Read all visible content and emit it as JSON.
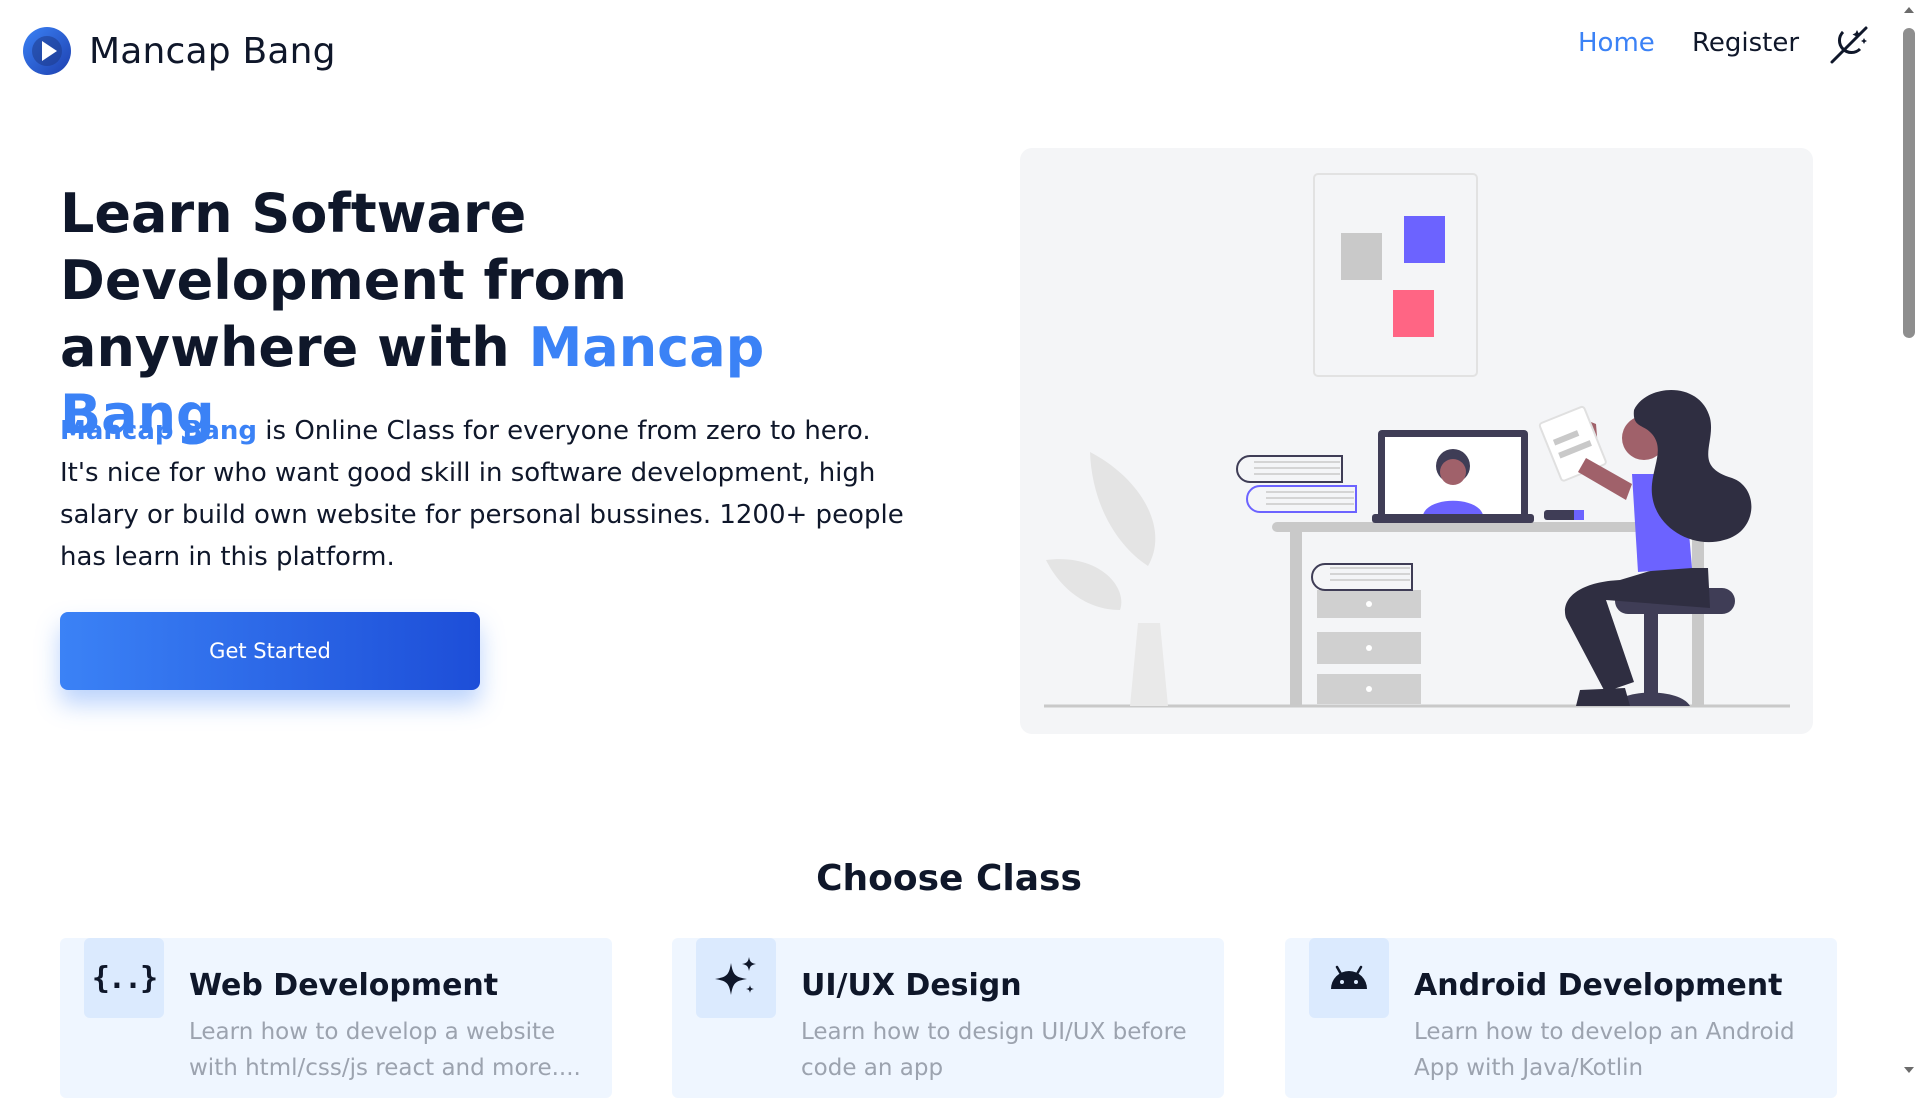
{
  "brand": {
    "name": "Mancap Bang",
    "logo_icon": "play-circle-icon"
  },
  "nav": {
    "items": [
      {
        "label": "Home",
        "active": true
      },
      {
        "label": "Register",
        "active": false
      }
    ],
    "theme_toggle_icon": "theme-toggle-icon"
  },
  "hero": {
    "title_part1": "Learn Software Development from anywhere with",
    "title_accent": "Mancap Bang",
    "desc_accent": "Mancap Bang",
    "desc_rest": " is Online Class for everyone from zero to hero. It's nice for who want good skill in software development, high salary or build own website for personal bussines. 1200+ people has learn in this platform.",
    "cta_label": "Get Started"
  },
  "classes": {
    "title": "Choose Class",
    "items": [
      {
        "title": "Web Development",
        "desc": "Learn how to develop a website with html/css/js react and more....",
        "icon": "code-braces-icon",
        "icon_glyph": "{..}"
      },
      {
        "title": "UI/UX Design",
        "desc": "Learn how to design UI/UX before code an app",
        "icon": "sparkles-icon"
      },
      {
        "title": "Android Development",
        "desc": "Learn how to develop an Android App with Java/Kotlin",
        "icon": "android-icon"
      }
    ]
  },
  "colors": {
    "accent": "#3b82f6",
    "accent_dark": "#1d4ed8",
    "text": "#0f172a",
    "muted": "#9ca3af",
    "card_bg": "#eff6ff",
    "illustration_purple": "#6c63ff",
    "illustration_pink": "#ff6584"
  }
}
